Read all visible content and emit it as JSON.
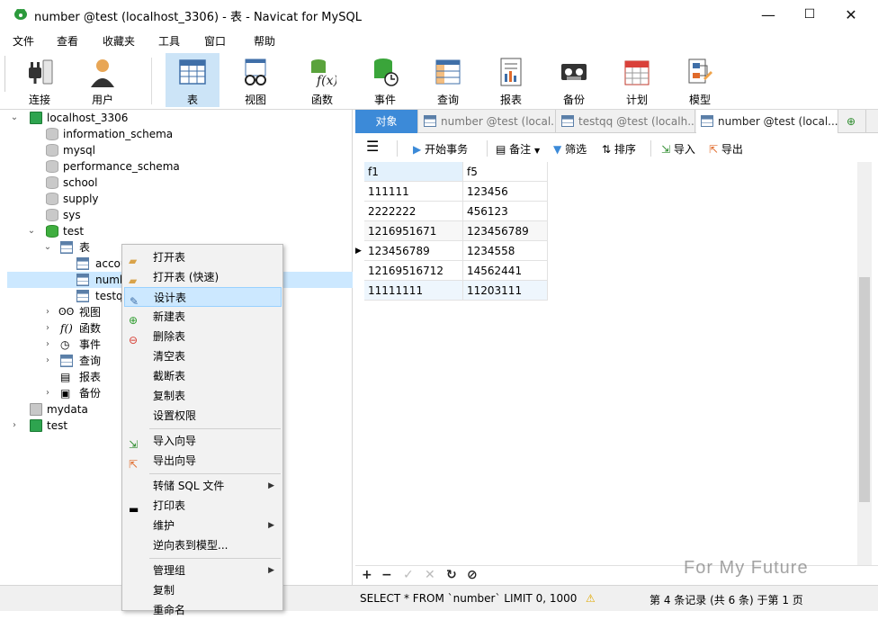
{
  "window": {
    "title": "number @test (localhost_3306) - 表 - Navicat for MySQL",
    "minimize": "—",
    "maximize": "☐",
    "close": "✕"
  },
  "menubar": [
    "文件",
    "查看",
    "收藏夹",
    "工具",
    "窗口",
    "帮助"
  ],
  "toolbar": [
    {
      "label": "连接",
      "icon": "plug-icon"
    },
    {
      "label": "用户",
      "icon": "user-icon"
    },
    {
      "label": "表",
      "icon": "table-icon"
    },
    {
      "label": "视图",
      "icon": "view-icon"
    },
    {
      "label": "函数",
      "icon": "function-icon"
    },
    {
      "label": "事件",
      "icon": "event-icon"
    },
    {
      "label": "查询",
      "icon": "query-icon"
    },
    {
      "label": "报表",
      "icon": "report-icon"
    },
    {
      "label": "备份",
      "icon": "backup-icon"
    },
    {
      "label": "计划",
      "icon": "calendar-icon"
    },
    {
      "label": "模型",
      "icon": "model-icon"
    }
  ],
  "tree": {
    "connection": "localhost_3306",
    "databases": [
      "information_schema",
      "mysql",
      "performance_schema",
      "school",
      "supply",
      "sys",
      "test"
    ],
    "test_children": {
      "tables_node": "表",
      "tables": [
        "accou",
        "numb",
        "testq"
      ],
      "others": [
        "视图",
        "函数",
        "事件",
        "查询",
        "报表",
        "备份"
      ]
    },
    "other_connections": [
      "mydata",
      "test"
    ]
  },
  "context_menu": {
    "group1": [
      "打开表",
      "打开表 (快速)",
      "设计表",
      "新建表",
      "删除表",
      "清空表",
      "截断表",
      "复制表",
      "设置权限"
    ],
    "group2": [
      "导入向导",
      "导出向导"
    ],
    "group3": [
      "转储 SQL 文件",
      "打印表",
      "维护",
      "逆向表到模型..."
    ],
    "group4": [
      "管理组",
      "复制",
      "重命名"
    ]
  },
  "tabs": {
    "object": "对象",
    "tab1": "number @test (local...",
    "tab2": "testqq @test (localh...",
    "tab3": "number @test (local..."
  },
  "data_toolbar": {
    "begin_txn": "开始事务",
    "note": "备注",
    "filter": "筛选",
    "sort": "排序",
    "import": "导入",
    "export": "导出"
  },
  "grid": {
    "columns": [
      "f1",
      "f5"
    ],
    "rows": [
      [
        "111111",
        "123456"
      ],
      [
        "2222222",
        "456123"
      ],
      [
        "1216951671",
        "123456789"
      ],
      [
        "123456789",
        "1234558"
      ],
      [
        "12169516712",
        "14562441"
      ],
      [
        "11111111",
        "11203111"
      ]
    ],
    "current_row_marker": "▶"
  },
  "status": {
    "sql": "SELECT * FROM `number` LIMIT 0, 1000",
    "record_info": "第 4 条记录 (共 6 条) 于第 1 页"
  },
  "watermark": "For My Future",
  "colors": {
    "tab_object_bg": "#3c8ad8",
    "selection": "#cce8ff",
    "toolbar_active": "#cce4f7"
  }
}
